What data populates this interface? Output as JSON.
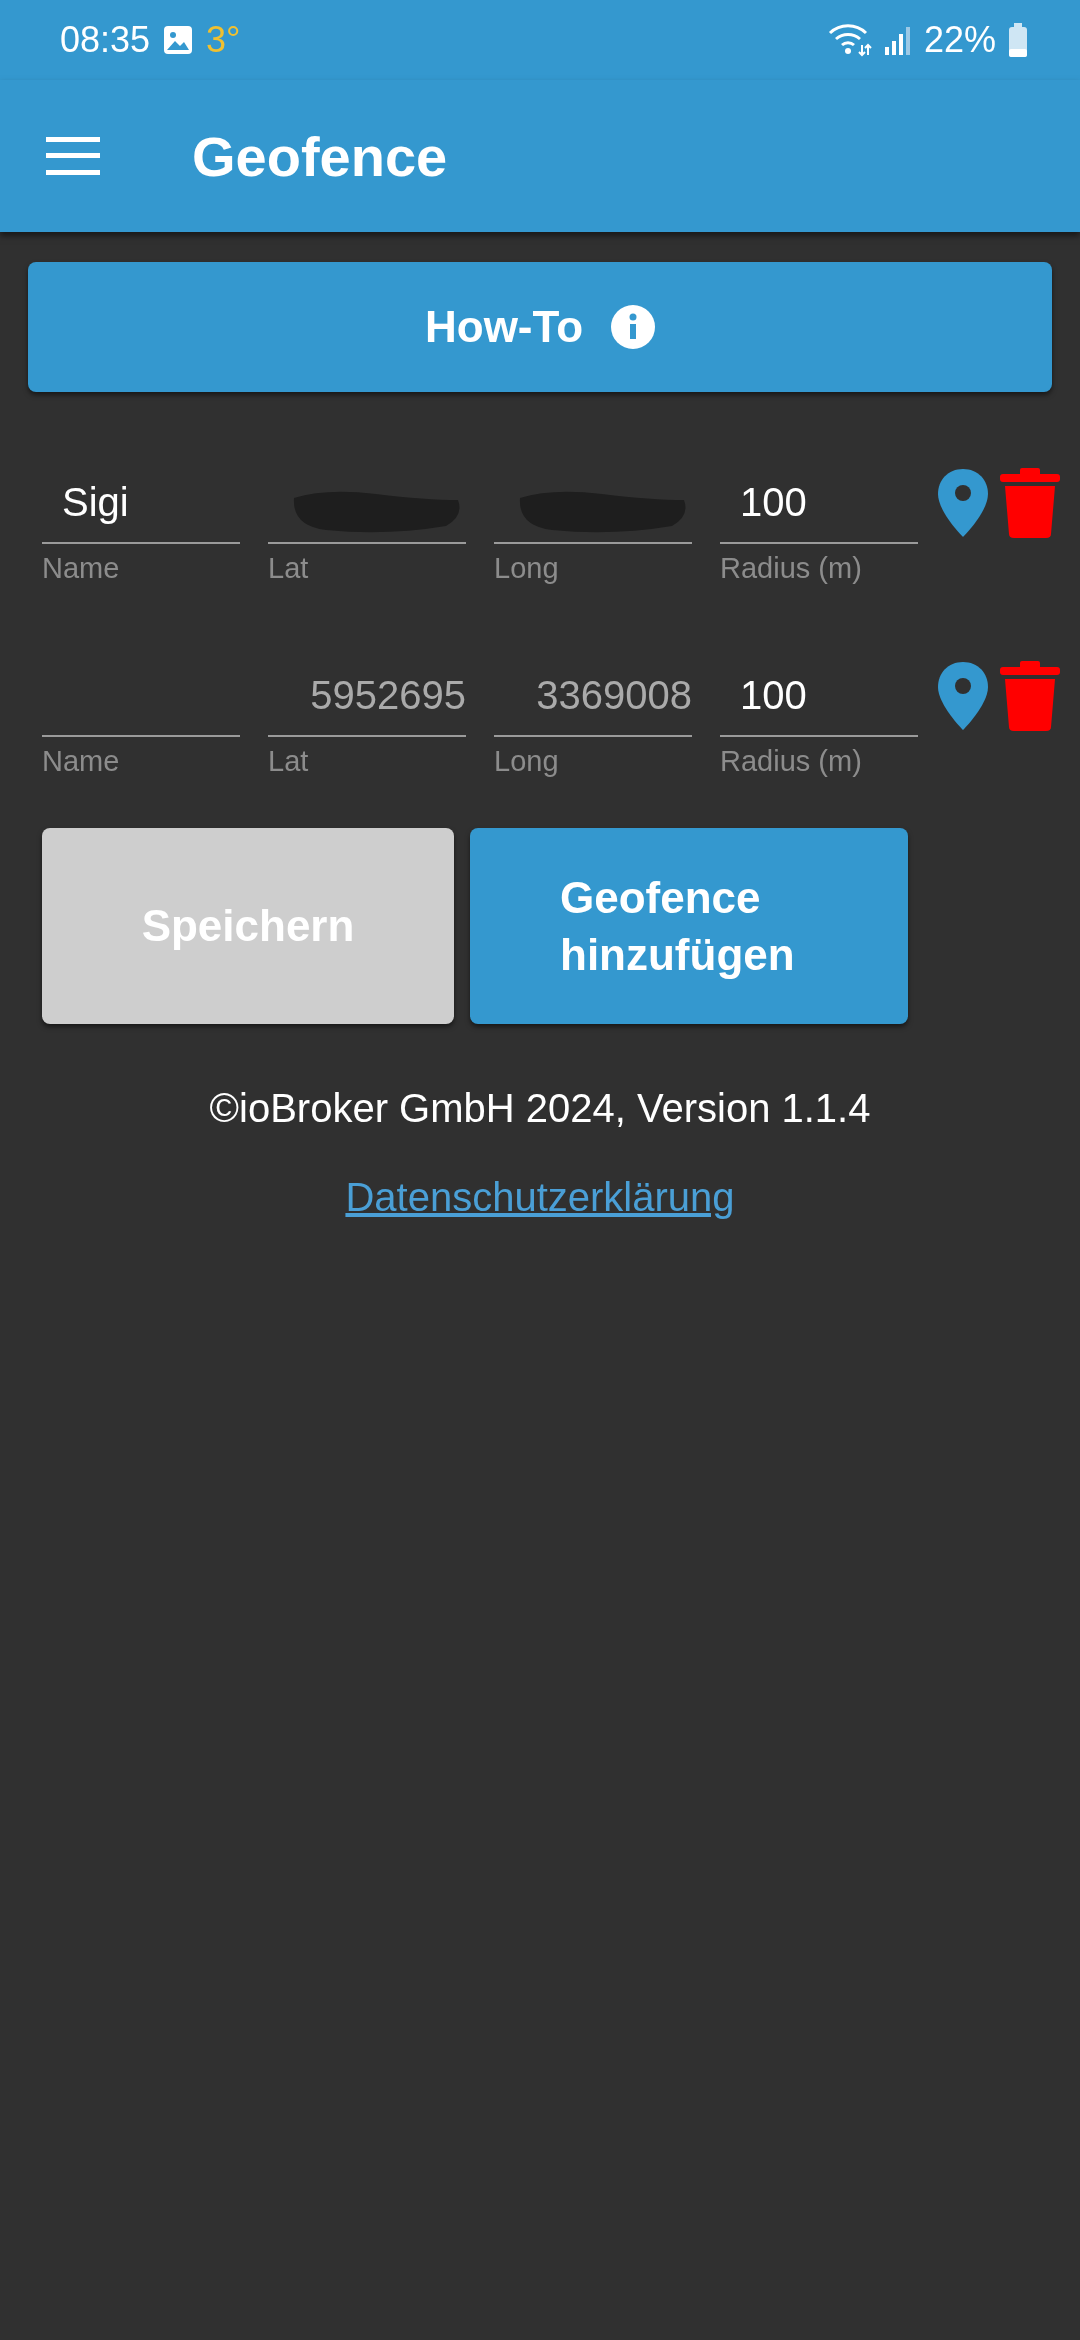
{
  "status_bar": {
    "time": "08:35",
    "temperature": "3°",
    "battery": "22%"
  },
  "app_bar": {
    "title": "Geofence"
  },
  "howto_button": {
    "label": "How-To"
  },
  "geofences": [
    {
      "fields": [
        {
          "label": "Name",
          "value": "Sigi",
          "redacted": false,
          "dimmed": false
        },
        {
          "label": "Lat",
          "redacted": true
        },
        {
          "label": "Long",
          "redacted": true
        },
        {
          "label": "Radius (m)",
          "value": "100",
          "redacted": false,
          "dimmed": false
        }
      ]
    },
    {
      "fields": [
        {
          "label": "Name",
          "redacted": false
        },
        {
          "label": "Lat",
          "value": "5952695",
          "redacted": false,
          "dimmed": true
        },
        {
          "label": "Long",
          "value": "3369008",
          "redacted": false,
          "dimmed": true
        },
        {
          "label": "Radius (m)",
          "value": "100",
          "redacted": false,
          "dimmed": false
        }
      ]
    }
  ],
  "buttons": [
    {
      "label": "Speichern",
      "disabled": true
    },
    {
      "label": "Geofence hinzufügen",
      "disabled": false
    }
  ],
  "footer": {
    "copyright": "©ioBroker GmbH 2024, Version 1.1.4",
    "link": "Datenschutzerklärung"
  }
}
